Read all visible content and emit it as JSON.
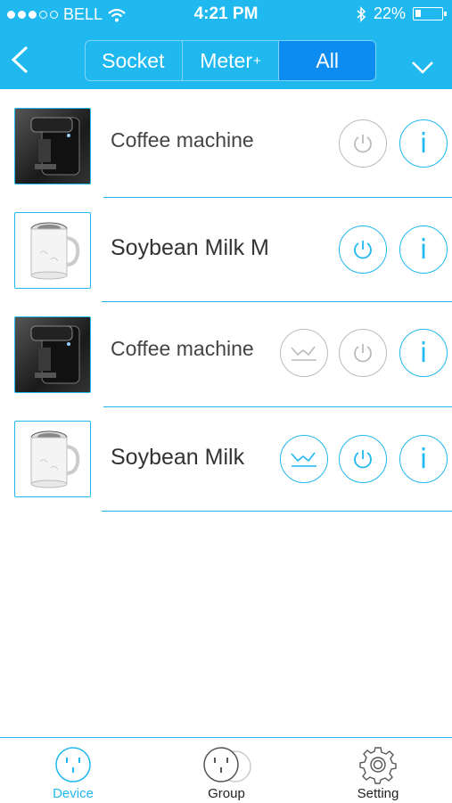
{
  "status_bar": {
    "carrier": "BELL",
    "time": "4:21 PM",
    "battery": "22%",
    "battery_level": 0.22
  },
  "header": {
    "segments": [
      {
        "label": "Socket",
        "sup": ""
      },
      {
        "label": "Meter",
        "sup": "+"
      },
      {
        "label": "All",
        "sup": ""
      }
    ],
    "active_segment": "All"
  },
  "devices": [
    {
      "name": "Coffee machine",
      "image": "coffee-machine",
      "has_chart": false,
      "power_on": false
    },
    {
      "name": "Soybean Milk M",
      "image": "soybean-milk-cup",
      "has_chart": false,
      "power_on": true
    },
    {
      "name": "Coffee machine",
      "image": "coffee-machine",
      "has_chart": true,
      "power_on": false
    },
    {
      "name": "Soybean Milk",
      "image": "soybean-milk-cup",
      "has_chart": true,
      "power_on": true
    }
  ],
  "info_label": "i",
  "tabbar": [
    {
      "label": "Device",
      "icon": "socket-icon",
      "active": true
    },
    {
      "label": "Group",
      "icon": "group-socket-icon",
      "active": false
    },
    {
      "label": "Setting",
      "icon": "gear-icon",
      "active": false
    }
  ],
  "colors": {
    "accent": "#1fb8ef",
    "active_segment": "#0c8cf0",
    "inactive_control": "#bbbbbb"
  }
}
